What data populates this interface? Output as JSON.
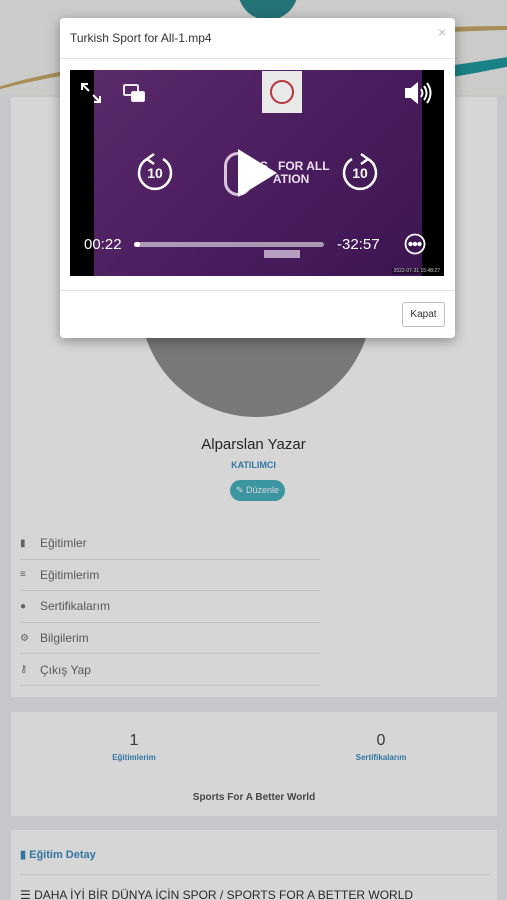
{
  "modal": {
    "title": "Turkish Sport for All-1.mp4",
    "close_symbol": "×",
    "close_button": "Kapat"
  },
  "video": {
    "elapsed": "00:22",
    "remaining": "-32:57",
    "progress_fraction": 0.011,
    "skip_back_seconds": "10",
    "skip_forward_seconds": "10",
    "brand_text_line1": "S   FOR ALL",
    "brand_text_line2": "    ATION",
    "timecode": "2022-07-31 15:48:27",
    "icons": [
      "expand-icon",
      "picture-in-picture-icon",
      "volume-icon",
      "rewind-10-icon",
      "play-icon",
      "forward-10-icon",
      "more-options-icon"
    ]
  },
  "profile": {
    "name": "Alparslan Yazar",
    "role": "KATILIMCI",
    "edit_label": "✎ Düzenle"
  },
  "menu": {
    "items": [
      {
        "label": "Eğitimler",
        "icon": "book-icon",
        "glyph": "▮"
      },
      {
        "label": "Eğitimlerim",
        "icon": "graduation-cap-icon",
        "glyph": "≡"
      },
      {
        "label": "Sertifikalarım",
        "icon": "certificate-icon",
        "glyph": "●"
      },
      {
        "label": "Bilgilerim",
        "icon": "gear-icon",
        "glyph": "⚙"
      },
      {
        "label": "Çıkış Yap",
        "icon": "key-icon",
        "glyph": "⚷"
      }
    ]
  },
  "stats": {
    "courses_count": "1",
    "courses_label": "Eğitimlerim",
    "certificates_count": "0",
    "certificates_label": "Sertifikalarım",
    "footer": "Sports For A Better World"
  },
  "detail": {
    "title": "▮ Eğitim Detay",
    "course": "☰ DAHA İYİ BİR DÜNYA İÇİN SPOR / SPORTS FOR A BETTER WORLD"
  },
  "colors": {
    "accent": "#3b8ec0",
    "edit_button": "#48b3c1",
    "video_bg": "#4a1d5e"
  }
}
